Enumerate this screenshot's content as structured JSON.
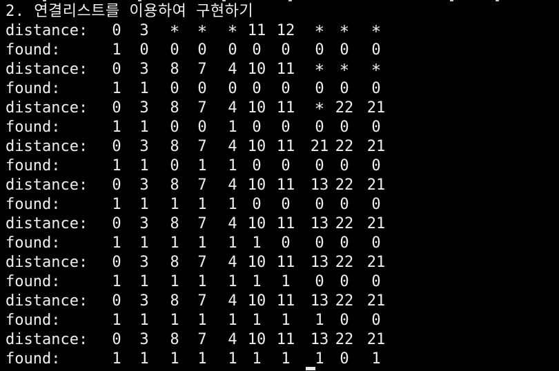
{
  "terminal": {
    "heading": "2. 연결리스트를 이용하여 구현하기",
    "rows": [
      {
        "label": "distance:",
        "cells": [
          "0",
          "3",
          "*",
          "*",
          "*",
          "11",
          "12",
          "*",
          "*",
          "*"
        ]
      },
      {
        "label": "found:",
        "cells": [
          "1",
          "0",
          "0",
          "0",
          "0",
          "0",
          "0",
          "0",
          "0",
          "0"
        ]
      },
      {
        "label": "distance:",
        "cells": [
          "0",
          "3",
          "8",
          "7",
          "4",
          "10",
          "11",
          "*",
          "*",
          "*"
        ]
      },
      {
        "label": "found:",
        "cells": [
          "1",
          "1",
          "0",
          "0",
          "0",
          "0",
          "0",
          "0",
          "0",
          "0"
        ]
      },
      {
        "label": "distance:",
        "cells": [
          "0",
          "3",
          "8",
          "7",
          "4",
          "10",
          "11",
          "*",
          "22",
          "21"
        ]
      },
      {
        "label": "found:",
        "cells": [
          "1",
          "1",
          "0",
          "0",
          "1",
          "0",
          "0",
          "0",
          "0",
          "0"
        ]
      },
      {
        "label": "distance:",
        "cells": [
          "0",
          "3",
          "8",
          "7",
          "4",
          "10",
          "11",
          "21",
          "22",
          "21"
        ]
      },
      {
        "label": "found:",
        "cells": [
          "1",
          "1",
          "0",
          "1",
          "1",
          "0",
          "0",
          "0",
          "0",
          "0"
        ]
      },
      {
        "label": "distance:",
        "cells": [
          "0",
          "3",
          "8",
          "7",
          "4",
          "10",
          "11",
          "13",
          "22",
          "21"
        ]
      },
      {
        "label": "found:",
        "cells": [
          "1",
          "1",
          "1",
          "1",
          "1",
          "0",
          "0",
          "0",
          "0",
          "0"
        ]
      },
      {
        "label": "distance:",
        "cells": [
          "0",
          "3",
          "8",
          "7",
          "4",
          "10",
          "11",
          "13",
          "22",
          "21"
        ]
      },
      {
        "label": "found:",
        "cells": [
          "1",
          "1",
          "1",
          "1",
          "1",
          "1",
          "0",
          "0",
          "0",
          "0"
        ]
      },
      {
        "label": "distance:",
        "cells": [
          "0",
          "3",
          "8",
          "7",
          "4",
          "10",
          "11",
          "13",
          "22",
          "21"
        ]
      },
      {
        "label": "found:",
        "cells": [
          "1",
          "1",
          "1",
          "1",
          "1",
          "1",
          "1",
          "0",
          "0",
          "0"
        ]
      },
      {
        "label": "distance:",
        "cells": [
          "0",
          "3",
          "8",
          "7",
          "4",
          "10",
          "11",
          "13",
          "22",
          "21"
        ]
      },
      {
        "label": "found:",
        "cells": [
          "1",
          "1",
          "1",
          "1",
          "1",
          "1",
          "1",
          "1",
          "0",
          "0"
        ]
      },
      {
        "label": "distance:",
        "cells": [
          "0",
          "3",
          "8",
          "7",
          "4",
          "10",
          "11",
          "13",
          "22",
          "21"
        ]
      },
      {
        "label": "found:",
        "cells": [
          "1",
          "1",
          "1",
          "1",
          "1",
          "1",
          "1",
          "1",
          "0",
          "1"
        ]
      }
    ]
  },
  "colors": {
    "background": "#000000",
    "text": "#f0f0f0"
  }
}
